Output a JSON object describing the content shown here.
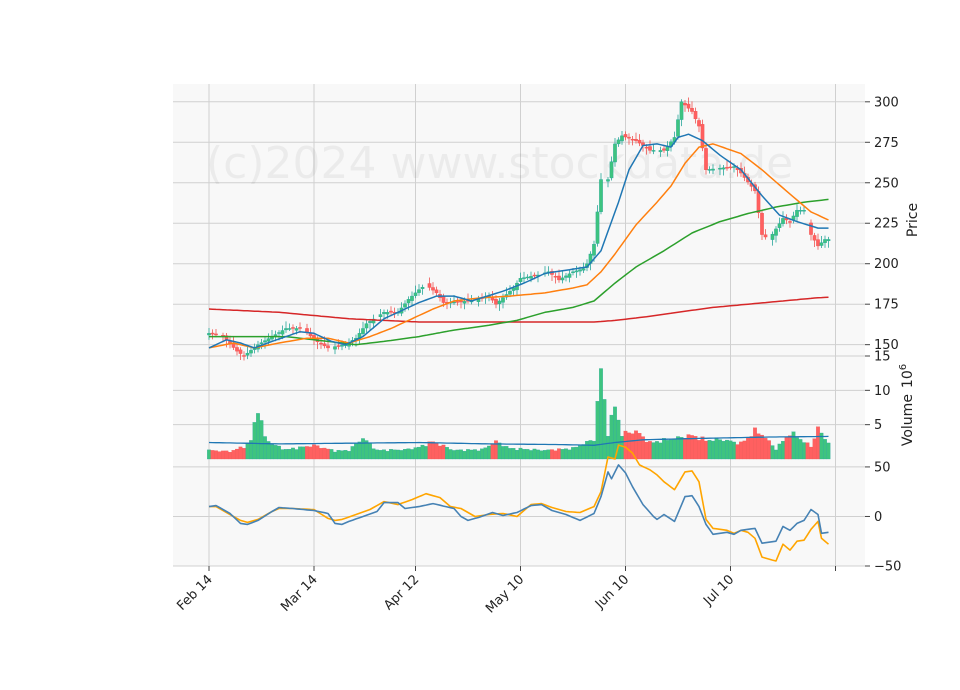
{
  "watermark": "(c)2024 www.stockdata.de",
  "colors": {
    "up": "#26a69a",
    "up_fill": "#3ec47f",
    "down": "#ef5350",
    "down_fill": "#ff6060",
    "ma_short": "#1f77b4",
    "ma_mid": "#ff7f0e",
    "ma_long": "#2ca02c",
    "ma_200": "#d62728",
    "vol_ma": "#1f77b4",
    "osc_blue": "#4682b4",
    "osc_orange": "#ffa500",
    "panel_bg": "#f8f8f8",
    "grid": "#d0d0d0"
  },
  "chart_data": {
    "type": "candlestick",
    "x_tick_labels": [
      "Feb 14",
      "Mar 14",
      "Apr 12",
      "May 10",
      "Jun 10",
      "Jul 10"
    ],
    "price_axis": {
      "label": "Price",
      "ylim": [
        143,
        311
      ],
      "ticks": [
        "150",
        "175",
        "200",
        "225",
        "250",
        "275",
        "300"
      ]
    },
    "volume_axis": {
      "label": "Volume",
      "unit": "10",
      "exponent": "6",
      "ylim": [
        0,
        15
      ],
      "ticks": [
        "5",
        "10",
        "15"
      ]
    },
    "oscillator_axis": {
      "ylim": [
        -50,
        58
      ],
      "ticks": [
        "-50",
        "0",
        "50"
      ]
    },
    "grid": true,
    "price_overview": {
      "start_close": 157,
      "trough": 143,
      "april_high": 187,
      "may_breakout": 252,
      "peak_high": 306,
      "end_close": 209
    },
    "moving_averages": [
      {
        "start": 148,
        "peak": 280,
        "end": 216
      },
      {
        "start": 148,
        "peak": 274,
        "end": 219
      },
      {
        "start": 155,
        "peak": 246,
        "end": 244
      },
      {
        "start": 172,
        "min": 164,
        "end": 183
      }
    ],
    "volume_overview": {
      "typical": 1.5,
      "max": 14.5,
      "ma_level": 2.8
    },
    "oscillator_overview": {
      "start": 10,
      "max": 58,
      "min": -45,
      "end": -6
    }
  }
}
